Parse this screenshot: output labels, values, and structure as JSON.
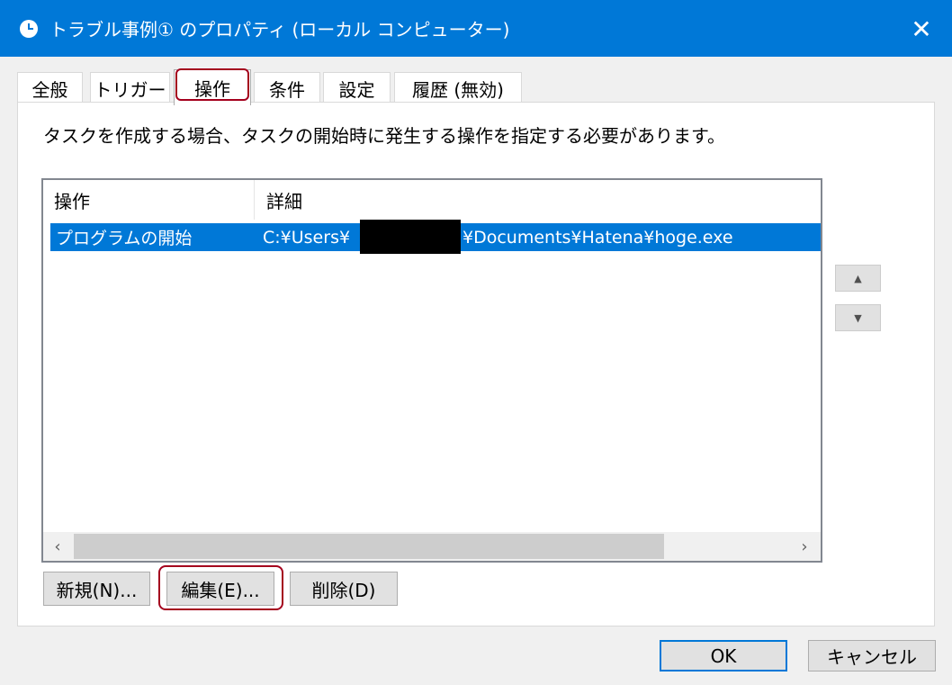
{
  "window": {
    "title": "トラブル事例① のプロパティ (ローカル コンピューター)",
    "title_icon": "clock-icon",
    "close_glyph": "✕",
    "accent_color": "#0078d7"
  },
  "tabs": [
    {
      "label": "全般"
    },
    {
      "label": "トリガー"
    },
    {
      "label": "操作",
      "active": true
    },
    {
      "label": "条件"
    },
    {
      "label": "設定"
    },
    {
      "label": "履歴 (無効)"
    }
  ],
  "description": "タスクを作成する場合、タスクの開始時に発生する操作を指定する必要があります。",
  "actions_table": {
    "columns": [
      "操作",
      "詳細"
    ],
    "rows": [
      {
        "action": "プログラムの開始",
        "detail_prefix": "C:¥Users¥",
        "detail_suffix": "¥Documents¥Hatena¥hoge.exe",
        "selected": true
      }
    ]
  },
  "scroll": {
    "left_glyph": "‹",
    "right_glyph": "›"
  },
  "side_buttons": {
    "up_glyph": "▲",
    "down_glyph": "▼"
  },
  "buttons": {
    "new": "新規(N)...",
    "edit": "編集(E)...",
    "delete": "削除(D)",
    "ok": "OK",
    "cancel": "キャンセル"
  },
  "highlight_color": "#a4001d"
}
